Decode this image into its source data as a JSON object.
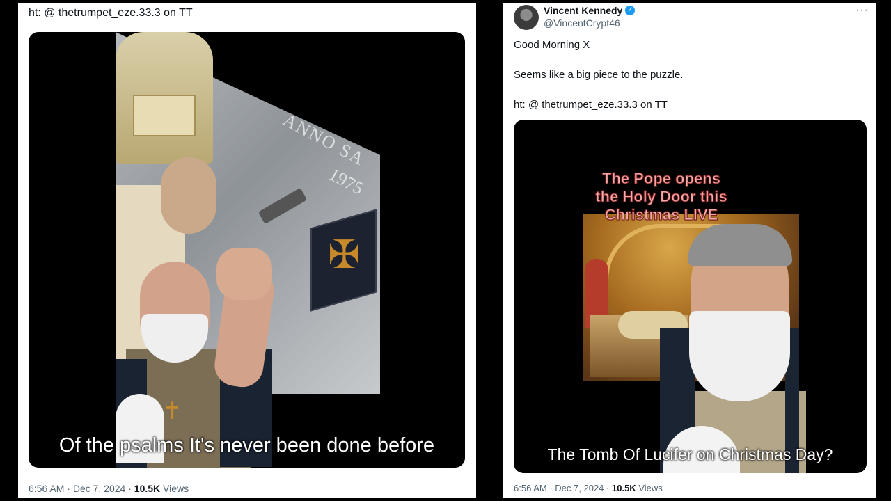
{
  "left": {
    "ht_line": "ht: @ thetrumpet_eze.33.3 on TT",
    "video_caption": "Of the psalms It's never been done before",
    "overlay_anno": "ANNO SA",
    "overlay_year": "1975",
    "footer": {
      "time": "6:56 AM",
      "sep": "·",
      "date": "Dec 7, 2024",
      "views_count": "10.5K",
      "views_label": "Views"
    }
  },
  "right": {
    "author": {
      "name": "Vincent Kennedy",
      "handle": "@VincentCrypt46"
    },
    "more_menu": "···",
    "verified_glyph": "✓",
    "body": [
      "Good Morning X",
      "Seems like a big piece to the puzzle.",
      "ht: @ thetrumpet_eze.33.3 on TT"
    ],
    "overlay_text": "The Pope opens the Holy Door this Christmas LIVE",
    "video_caption": "The Tomb Of Lucifer on Christmas Day?",
    "footer": {
      "time": "6:56 AM",
      "sep": "·",
      "date": "Dec 7, 2024",
      "views_count": "10.5K",
      "views_label": "Views"
    }
  },
  "icons": {
    "cross": "✠",
    "pendant": "✝",
    "verified": "verified-badge-icon"
  },
  "colors": {
    "background": "#000000",
    "card": "#ffffff",
    "muted_text": "#536471",
    "verified_blue": "#1d9bf0"
  }
}
